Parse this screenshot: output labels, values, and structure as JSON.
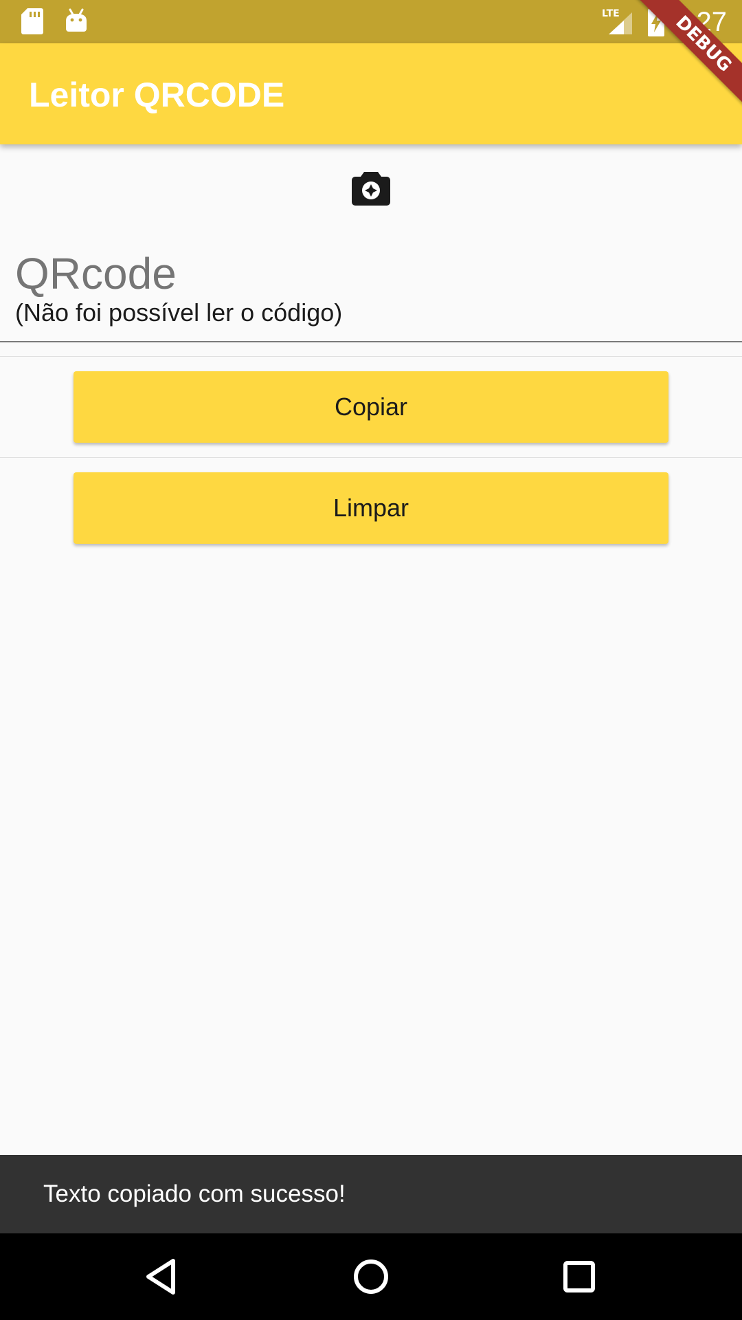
{
  "colors": {
    "status_bar": "#c1a32f",
    "primary": "#fed841",
    "background": "#fafafa",
    "snackbar": "#323232",
    "debug_ribbon": "#a5322a"
  },
  "status_bar": {
    "time": "9:27",
    "left_icons": [
      "sd-card-icon",
      "android-debug-icon"
    ],
    "right_icons": [
      "lte-signal-icon",
      "battery-charging-icon"
    ]
  },
  "app_bar": {
    "title": "Leitor QRCODE"
  },
  "debug_banner": {
    "label": "DEBUG"
  },
  "scanner": {
    "camera_icon": "camera-icon"
  },
  "qr_field": {
    "label": "QRcode",
    "value": "(Não foi possível ler o código)"
  },
  "buttons": {
    "copy_label": "Copiar",
    "clear_label": "Limpar"
  },
  "snackbar": {
    "message": "Texto copiado com sucesso!"
  },
  "nav_bar": {
    "icons": [
      "back-icon",
      "home-icon",
      "recents-icon"
    ]
  }
}
